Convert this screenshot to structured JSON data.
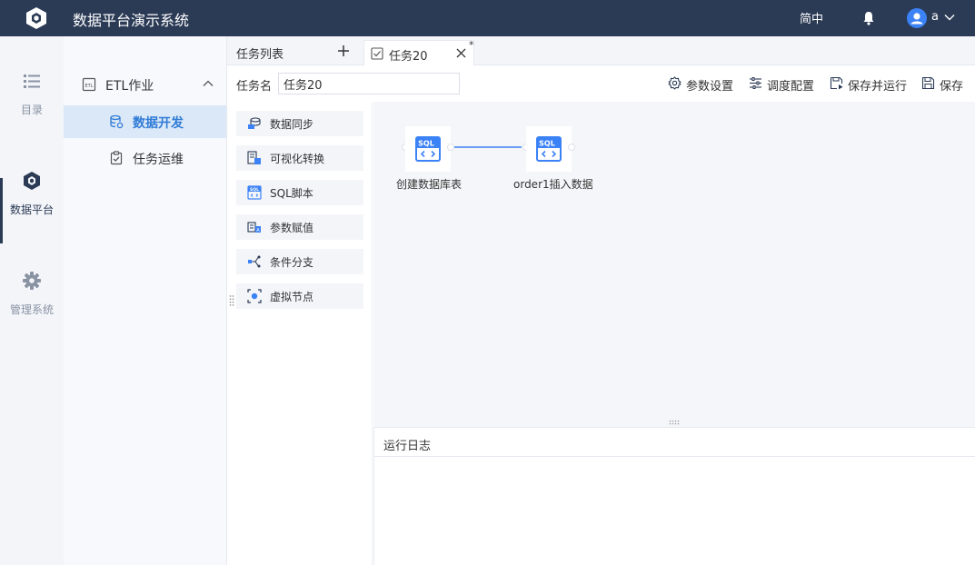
{
  "header": {
    "app_title": "数据平台演示系统",
    "language": "简中",
    "username": "a"
  },
  "leftnav": {
    "items": [
      {
        "label": "目录"
      },
      {
        "label": "数据平台"
      },
      {
        "label": "管理系统"
      }
    ]
  },
  "sidebar": {
    "group_label": "ETL作业",
    "items": [
      {
        "label": "数据开发"
      },
      {
        "label": "任务运维"
      }
    ]
  },
  "tabs": {
    "list_title": "任务列表",
    "open_tab": {
      "label": "任务20",
      "dirty_marker": "*"
    }
  },
  "toolbar": {
    "task_name_label": "任务名",
    "task_name_value": "任务20",
    "buttons": [
      {
        "label": "参数设置"
      },
      {
        "label": "调度配置"
      },
      {
        "label": "保存并运行"
      },
      {
        "label": "保存"
      }
    ]
  },
  "palette": {
    "items": [
      {
        "label": "数据同步"
      },
      {
        "label": "可视化转换"
      },
      {
        "label": "SQL脚本"
      },
      {
        "label": "参数赋值"
      },
      {
        "label": "条件分支"
      },
      {
        "label": "虚拟节点"
      }
    ]
  },
  "canvas": {
    "nodes": [
      {
        "label": "创建数据库表",
        "icon_text": "SQL"
      },
      {
        "label": "order1插入数据",
        "icon_text": "SQL"
      }
    ]
  },
  "log": {
    "title": "运行日志"
  },
  "colors": {
    "header_bg": "#2b3a55",
    "accent": "#2f7bd6",
    "active_item_bg": "#dbe8f8",
    "canvas_bg": "#f5f6f9",
    "sql_icon": "#3b82f6"
  }
}
